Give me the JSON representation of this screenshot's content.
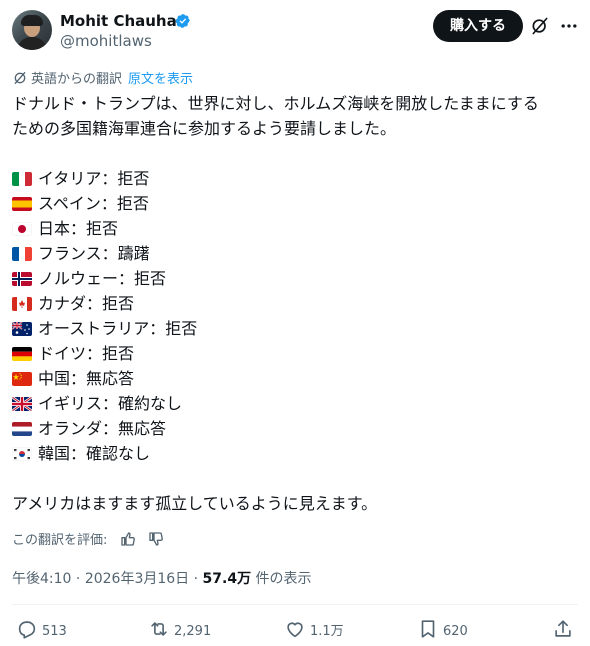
{
  "author": {
    "name": "Mohit Chauhan",
    "handle": "@mohitlaws"
  },
  "buy_button": "購入する",
  "translation": {
    "label": "英語からの翻訳",
    "show_original": "原文を表示"
  },
  "intro_lines": [
    "ドナルド・トランプは、世界に対し、ホルムズ海峡を開放したままにする",
    "ための多国籍海軍連合に参加するよう要請しました。"
  ],
  "countries": [
    {
      "flag": "italy",
      "text": "イタリア：拒否"
    },
    {
      "flag": "spain",
      "text": "スペイン：拒否"
    },
    {
      "flag": "japan",
      "text": "日本：拒否"
    },
    {
      "flag": "france",
      "text": "フランス：躊躇"
    },
    {
      "flag": "norway",
      "text": "ノルウェー：拒否"
    },
    {
      "flag": "canada",
      "text": "カナダ：拒否"
    },
    {
      "flag": "australia",
      "text": "オーストラリア：拒否"
    },
    {
      "flag": "germany",
      "text": "ドイツ：拒否"
    },
    {
      "flag": "china",
      "text": "中国：無応答"
    },
    {
      "flag": "uk",
      "text": "イギリス：確約なし"
    },
    {
      "flag": "netherlands",
      "text": "オランダ：無応答"
    },
    {
      "flag": "korea",
      "text": "韓国：確認なし"
    }
  ],
  "closing": "アメリカはますます孤立しているように見えます。",
  "rate_translation": "この翻訳を評価:",
  "meta": {
    "time": "午後4:10",
    "date": "2026年3月16日",
    "views_count": "57.4万",
    "views_label": "件の表示",
    "sep": " · "
  },
  "actions": {
    "replies": "513",
    "reposts": "2,291",
    "likes": "1.1万",
    "bookmarks": "620"
  },
  "colors": {
    "accent": "#1d9bf0",
    "text": "#0f1419",
    "muted": "#536471"
  }
}
